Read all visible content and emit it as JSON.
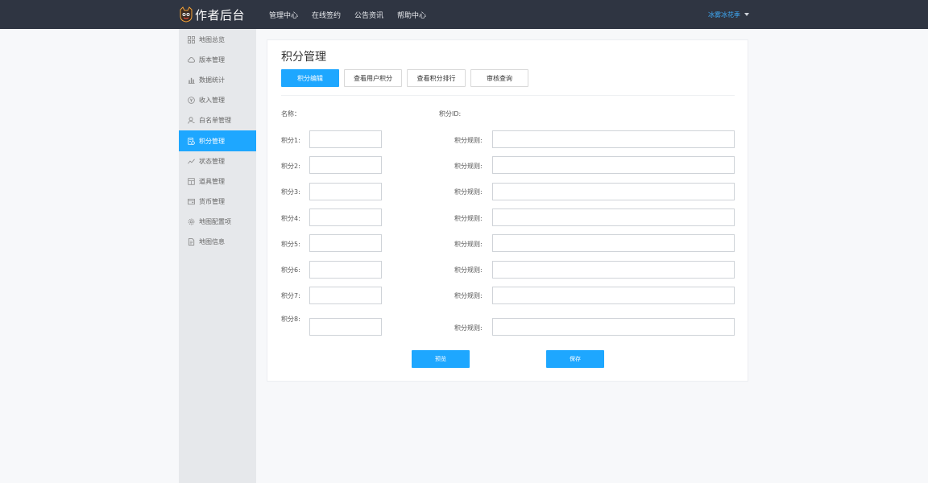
{
  "header": {
    "app_title": "作者后台",
    "nav": [
      "管理中心",
      "在线签约",
      "公告资讯",
      "帮助中心"
    ],
    "user_name": "冰雾冰花季"
  },
  "sidebar": {
    "items": [
      {
        "label": "地图总览",
        "icon": "grid-icon"
      },
      {
        "label": "版本管理",
        "icon": "cloud-icon"
      },
      {
        "label": "数据统计",
        "icon": "bar-chart-icon"
      },
      {
        "label": "收入管理",
        "icon": "coin-icon"
      },
      {
        "label": "白名单管理",
        "icon": "user-icon"
      },
      {
        "label": "积分管理",
        "icon": "points-icon",
        "active": true
      },
      {
        "label": "状态管理",
        "icon": "trend-icon"
      },
      {
        "label": "道具管理",
        "icon": "box-icon"
      },
      {
        "label": "货币管理",
        "icon": "wallet-icon"
      },
      {
        "label": "地图配置项",
        "icon": "settings-icon"
      },
      {
        "label": "地图信息",
        "icon": "document-icon"
      }
    ]
  },
  "main": {
    "title": "积分管理",
    "tabs": [
      "积分编辑",
      "查看用户积分",
      "查看积分排行",
      "审核查询"
    ],
    "name_label": "名称：",
    "id_label": "积分ID:",
    "rows": [
      {
        "points_label": "积分1:",
        "rule_label": "积分规则:"
      },
      {
        "points_label": "积分2:",
        "rule_label": "积分规则:"
      },
      {
        "points_label": "积分3:",
        "rule_label": "积分规则:"
      },
      {
        "points_label": "积分4:",
        "rule_label": "积分规则:"
      },
      {
        "points_label": "积分5:",
        "rule_label": "积分规则:"
      },
      {
        "points_label": "积分6:",
        "rule_label": "积分规则:"
      },
      {
        "points_label": "积分7:",
        "rule_label": "积分规则:"
      },
      {
        "points_label": "积分8:",
        "rule_label": "积分规则:"
      }
    ],
    "preview_label": "预览",
    "save_label": "保存"
  },
  "colors": {
    "topbar": "#2f3542",
    "accent": "#1ea7ff",
    "sidebar": "#e6e8eb"
  }
}
